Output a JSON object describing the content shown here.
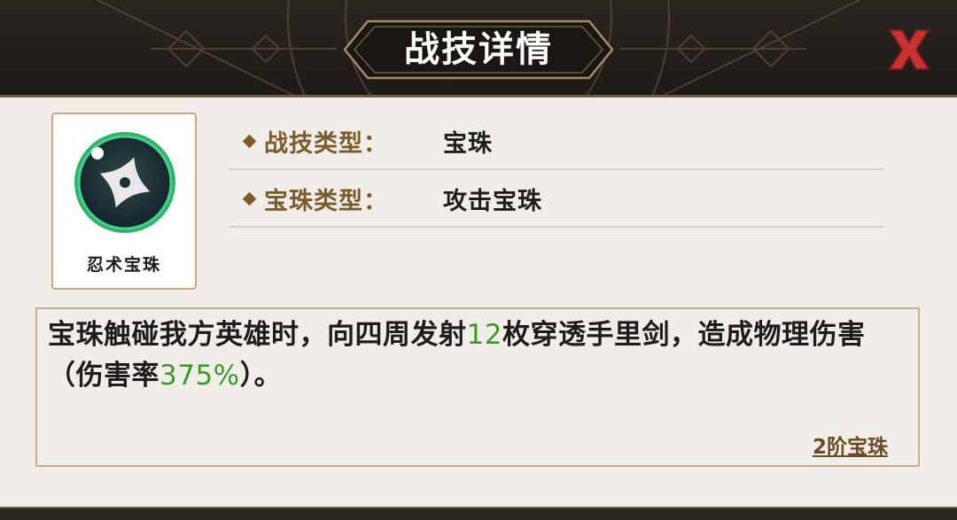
{
  "header": {
    "title": "战技详情"
  },
  "close_button": {
    "glyph": "X",
    "color": "#c83232"
  },
  "gem": {
    "name": "忍术宝珠",
    "icon": "shuriken-orb-icon"
  },
  "info": [
    {
      "label": "战技类型：",
      "value": "宝珠"
    },
    {
      "label": "宝珠类型：",
      "value": "攻击宝珠"
    }
  ],
  "description": {
    "part1": "宝珠触碰我方英雄时，向四周发射",
    "count": "12",
    "part2": "枚穿透手里剑，造成物理伤害（伤害率",
    "rate": "375%",
    "part3": "）。"
  },
  "tier_link": "2阶宝珠",
  "colors": {
    "accent_brown": "#7a5b2d",
    "highlight_green": "#3b9a2a",
    "header_bg": "#1e1a16"
  }
}
